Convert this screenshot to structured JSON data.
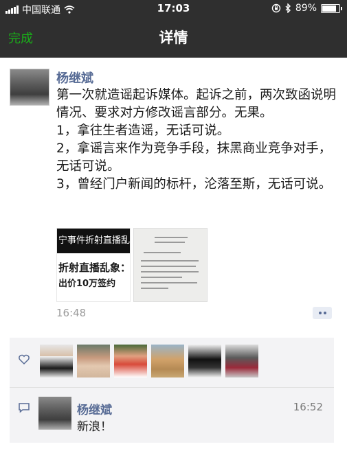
{
  "status_bar": {
    "carrier": "中国联通",
    "time": "17:03",
    "battery": "89%",
    "battery_level": 0.89,
    "icons": [
      "signal-icon",
      "wifi-icon",
      "rotation-lock-icon",
      "bluetooth-icon",
      "battery-icon"
    ]
  },
  "nav": {
    "done_label": "完成",
    "title": "详情"
  },
  "post": {
    "author": "杨继斌",
    "lines": [
      "第一次就造谣起诉媒体。起诉之前，两次致函说明情况、要求对方修改谣言部分。无果。",
      "1，拿往生者造谣，无话可说。",
      "2，拿谣言来作为竞争手段，抹黑商业竞争对手，无话可说。",
      "3，曾经门户新闻的标杆，沦落至斯，无话可说。"
    ],
    "image1": {
      "line1": "宁事件折射直播乱象",
      "line2": "折射直播乱象：",
      "line3": "出价10万签约"
    },
    "time": "16:48"
  },
  "likes": {
    "icon": "heart-icon",
    "count_shown": 6
  },
  "comment": {
    "icon": "comment-icon",
    "author": "杨继斌",
    "time": "16:52",
    "text": "新浪！"
  },
  "colors": {
    "wechat_green": "#1aad19",
    "link_blue": "#576b95",
    "bar_dark": "#2f2f2f",
    "panel_gray": "#f3f3f5"
  }
}
